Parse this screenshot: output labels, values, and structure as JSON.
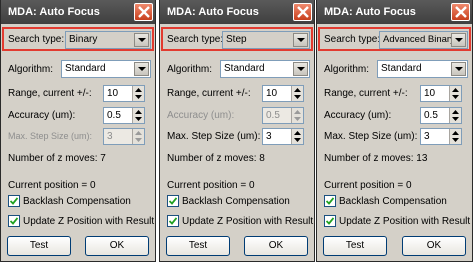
{
  "windows": [
    {
      "title": "MDA: Auto Focus",
      "search_type_label": "Search type:",
      "search_type_value": "Binary",
      "algorithm_label": "Algorithm:",
      "algorithm_value": "Standard",
      "range_label": "Range, current +/-:",
      "range_value": "10",
      "accuracy_label": "Accuracy (um):",
      "accuracy_value": "0.5",
      "max_step_label": "Max. Step Size (um):",
      "max_step_value": "3",
      "z_moves_text": "Number of z moves: 7",
      "current_position_text": "Current position = 0",
      "backlash_label": "Backlash Compensation",
      "update_z_label": "Update Z Position with Result",
      "test_label": "Test",
      "ok_label": "OK"
    },
    {
      "title": "MDA: Auto Focus",
      "search_type_label": "Search type:",
      "search_type_value": "Step",
      "algorithm_label": "Algorithm:",
      "algorithm_value": "Standard",
      "range_label": "Range, current +/-:",
      "range_value": "10",
      "accuracy_label": "Accuracy (um):",
      "accuracy_value": "0.5",
      "max_step_label": "Max. Step Size (um):",
      "max_step_value": "3",
      "z_moves_text": "Number of z moves: 8",
      "current_position_text": "Current position = 0",
      "backlash_label": "Backlash Compensation",
      "update_z_label": "Update Z Position with Result",
      "test_label": "Test",
      "ok_label": "OK"
    },
    {
      "title": "MDA: Auto Focus",
      "search_type_label": "Search type:",
      "search_type_value": "Advanced Binary",
      "algorithm_label": "Algorithm:",
      "algorithm_value": "Standard",
      "range_label": "Range, current +/-:",
      "range_value": "10",
      "accuracy_label": "Accuracy (um):",
      "accuracy_value": "0.5",
      "max_step_label": "Max. Step Size (um):",
      "max_step_value": "3",
      "z_moves_text": "Number of z moves: 13",
      "current_position_text": "Current position = 0",
      "backlash_label": "Backlash Compensation",
      "update_z_label": "Update Z Position with Result",
      "test_label": "Test",
      "ok_label": "OK"
    }
  ],
  "colors": {
    "titlebar": "#4a4a4a",
    "dialog_bg": "#d4d0c8",
    "highlight_box": "#e23b30",
    "close_button": "#d9532f"
  }
}
